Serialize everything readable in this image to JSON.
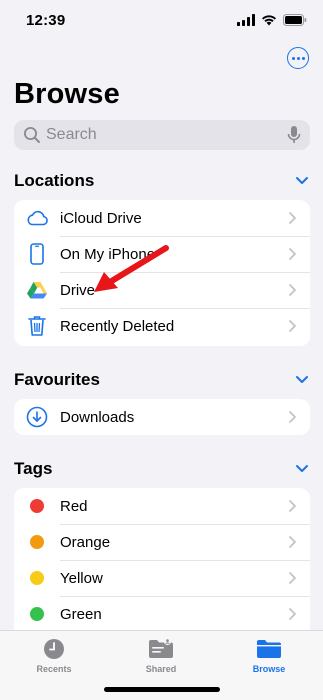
{
  "status": {
    "time": "12:39"
  },
  "header": {
    "title": "Browse"
  },
  "search": {
    "placeholder": "Search"
  },
  "locations": {
    "title": "Locations",
    "items": [
      {
        "label": "iCloud Drive",
        "icon": "icloud-icon"
      },
      {
        "label": "On My iPhone",
        "icon": "iphone-icon"
      },
      {
        "label": "Drive",
        "icon": "google-drive-icon"
      },
      {
        "label": "Recently Deleted",
        "icon": "trash-icon"
      }
    ]
  },
  "favourites": {
    "title": "Favourites",
    "items": [
      {
        "label": "Downloads",
        "icon": "download-icon"
      }
    ]
  },
  "tags": {
    "title": "Tags",
    "items": [
      {
        "label": "Red",
        "color": "#ef3b36"
      },
      {
        "label": "Orange",
        "color": "#f19a12"
      },
      {
        "label": "Yellow",
        "color": "#f6cc16"
      },
      {
        "label": "Green",
        "color": "#35c14d"
      }
    ]
  },
  "tabbar": {
    "tabs": [
      {
        "label": "Recents",
        "icon": "clock-icon"
      },
      {
        "label": "Shared",
        "icon": "shared-folder-icon"
      },
      {
        "label": "Browse",
        "icon": "folder-icon",
        "active": true
      }
    ]
  },
  "colors": {
    "accent": "#1a73e8",
    "annotation_arrow": "#e8161a"
  }
}
